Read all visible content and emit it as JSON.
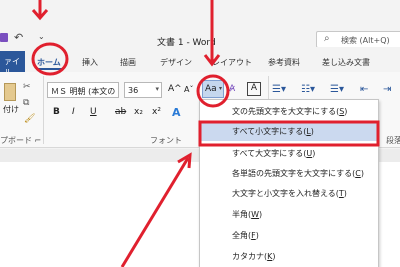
{
  "title_bar": {
    "doc_title": "文書 1  -  Word",
    "search_placeholder": "検索 (Alt+Q)",
    "quick_access_dropdown": "⌄"
  },
  "tabs": [
    {
      "label": "ァイル"
    },
    {
      "label": "ホーム"
    },
    {
      "label": "挿入"
    },
    {
      "label": "描画"
    },
    {
      "label": "デザイン"
    },
    {
      "label": "レイアウト"
    },
    {
      "label": "参考資料"
    },
    {
      "label": "差し込み文書"
    }
  ],
  "ribbon": {
    "paste_label": "付け",
    "clipboard_group": "プボード ⌐",
    "font_name": "ＭＳ 明朝 (本文の",
    "font_size": "36",
    "case_button": "Aa",
    "font_group": "フォント",
    "paragraph_group": "段落",
    "bold": "B",
    "italic": "I",
    "underline": "U",
    "strike": "ab",
    "subscript": "x₂",
    "superscript": "x²",
    "text_effect": "A",
    "grow": "A^",
    "shrink": "Aˇ",
    "char_border": "A"
  },
  "case_menu": {
    "items": [
      {
        "label": "文の先頭文字を大文字にする",
        "key": "S"
      },
      {
        "label": "すべて小文字にする",
        "key": "L"
      },
      {
        "label": "すべて大文字にする",
        "key": "U"
      },
      {
        "label": "各単語の先頭文字を大文字にする",
        "key": "C"
      },
      {
        "label": "大文字と小文字を入れ替える",
        "key": "T"
      },
      {
        "label": "半角",
        "key": "W"
      },
      {
        "label": "全角",
        "key": "F"
      },
      {
        "label": "カタカナ",
        "key": "K"
      }
    ],
    "highlighted_index": 1
  },
  "colors": {
    "accent": "#2b579a",
    "annotation": "#e0202e",
    "highlight": "#cbd9ef"
  },
  "icons": [
    "save-icon",
    "undo-icon",
    "search-icon",
    "paste-icon",
    "cut-icon",
    "copy-icon",
    "format-painter-icon",
    "bullets-icon",
    "numbering-icon",
    "multilevel-list-icon",
    "decrease-indent-icon",
    "increase-indent-icon",
    "clear-formatting-icon"
  ]
}
